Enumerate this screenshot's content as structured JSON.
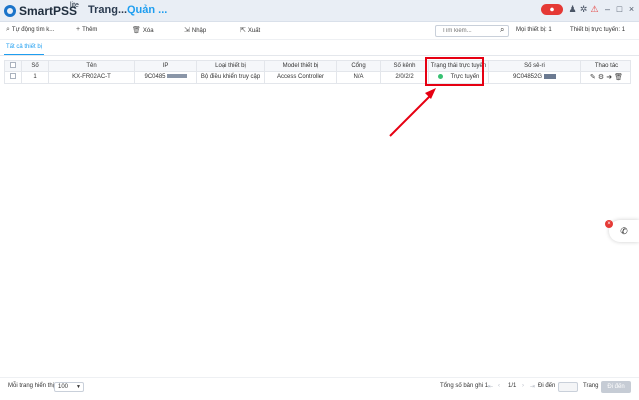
{
  "titlebar": {
    "brand": "SmartPSS",
    "brand_sup": "lite",
    "tabs": [
      "Trang...",
      "Quản ..."
    ],
    "record_badge": "⏺"
  },
  "toolbar": {
    "auto_search": "Tự động tìm k...",
    "add": "Thêm",
    "delete": "Xóa",
    "import": "Nhập",
    "export": "Xuất",
    "search_placeholder": "Tìm kiếm...",
    "all_devices_label": "Mọi thiết bị:",
    "all_devices_count": "1",
    "online_devices_label": "Thiết bị trực tuyến:",
    "online_devices_count": "1"
  },
  "subtab": "Tất cả thiết bị",
  "table": {
    "headers": [
      "Số",
      "Tên",
      "IP",
      "Loại thiết bị",
      "Model thiết bị",
      "Cổng",
      "Số kênh",
      "Trạng thái trực tuyến",
      "Số sê-ri",
      "Thao tác"
    ],
    "rows": [
      {
        "no": "1",
        "name": "KX-FR02AC-T",
        "ip": "9C0485",
        "device_type": "Bộ điều khiển truy cập",
        "model": "Access Controller",
        "port": "N/A",
        "channels": "2/0/2/2",
        "status": "Trực tuyến",
        "serial": "9C04852G"
      }
    ]
  },
  "colors": {
    "accent": "#1e9ef0",
    "online": "#38c172",
    "highlight": "#e60012"
  },
  "footer": {
    "per_page_label": "Mỗi trang hiển thị",
    "per_page_value": "100",
    "total_label": "Tổng số bản ghi 1.",
    "page_info": "1/1",
    "goto_label": "Đi đến",
    "page_label": "Trang",
    "goto_button": "Đi đến"
  }
}
